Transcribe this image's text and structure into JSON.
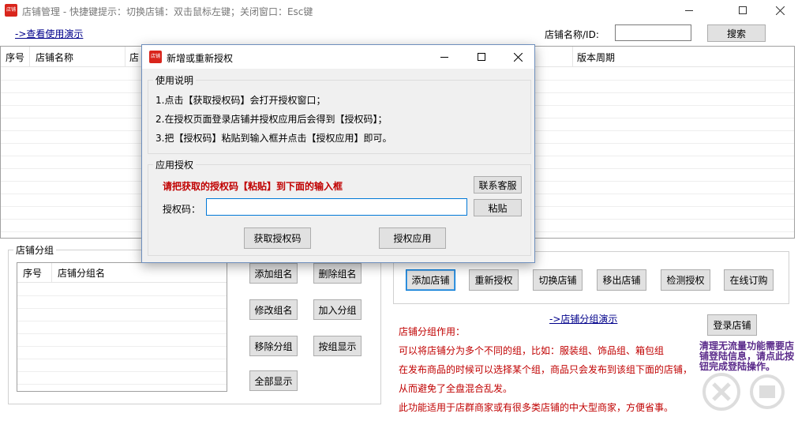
{
  "window": {
    "title": "店铺管理 - 快捷键提示：切换店铺：双击鼠标左键；关闭窗口：Esc键",
    "app_icon_text": "店铺"
  },
  "toolbar": {
    "help_link": "->查看使用演示",
    "search_label": "店铺名称/ID:",
    "search_value": "",
    "search_button": "搜索"
  },
  "main_table": {
    "columns": [
      "序号",
      "店铺名称",
      "店",
      "版本周期"
    ]
  },
  "group_panel": {
    "legend": "店铺分组",
    "columns": [
      "序号",
      "店铺分组名"
    ],
    "buttons": {
      "add": "添加组名",
      "delete": "删除组名",
      "rename": "修改组名",
      "join": "加入分组",
      "remove": "移除分组",
      "show_by_group": "按组显示",
      "show_all": "全部显示"
    }
  },
  "actions": {
    "add_shop": "添加店铺",
    "reauth": "重新授权",
    "switch_shop": "切换店铺",
    "remove_shop": "移出店铺",
    "check_auth": "检测授权",
    "order_online": "在线订购",
    "group_demo_link": "->店铺分组演示",
    "login_shop": "登录店铺"
  },
  "info": {
    "lines": [
      "店铺分组作用：",
      "可以将店铺分为多个不同的组，比如：服装组、饰品组、箱包组",
      "在发布商品的时候可以选择某个组，商品只会发布到该组下面的店铺，",
      "从而避免了全盘混合乱发。",
      "此功能适用于店群商家或有很多类店铺的中大型商家，方便省事。"
    ],
    "side_note": "清理无流量功能需要店铺登陆信息，请点此按钮完成登陆操作。"
  },
  "dialog": {
    "title": "新增或重新授权",
    "instructions_legend": "使用说明",
    "instructions": [
      "1.点击【获取授权码】会打开授权窗口；",
      "2.在授权页面登录店铺并授权应用后会得到【授权码】；",
      "3.把【授权码】粘贴到输入框并点击【授权应用】即可。"
    ],
    "apply_legend": "应用授权",
    "warning": "请把获取的授权码【粘贴】到下面的输入框",
    "contact_button": "联系客服",
    "code_label": "授权码：",
    "code_value": "",
    "paste_button": "粘贴",
    "get_code_button": "获取授权码",
    "apply_button": "授权应用"
  },
  "colors": {
    "warning_red": "#c00000",
    "note_purple": "#5a2a8a",
    "link_blue": "#00008b",
    "focus_blue": "#0078d7"
  }
}
